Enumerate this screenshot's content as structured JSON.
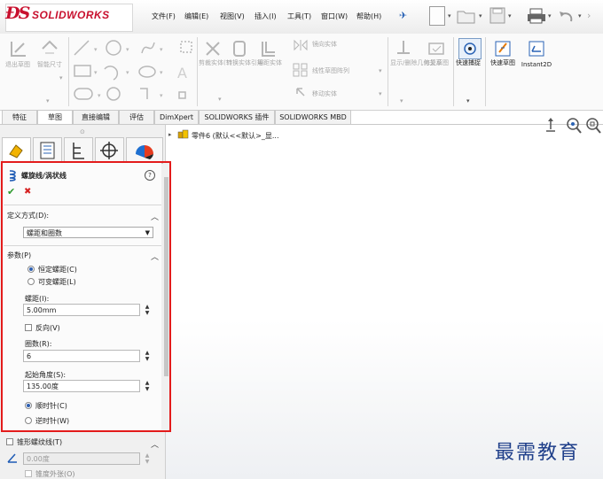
{
  "app": {
    "brand": "SOLIDWORKS",
    "brand_color": "#c8102e"
  },
  "menu": [
    "文件(F)",
    "编辑(E)",
    "视图(V)",
    "插入(I)",
    "工具(T)",
    "窗口(W)",
    "帮助(H)"
  ],
  "ribbon": {
    "groups": [
      {
        "label": "退出草图",
        "icon": "exit-sketch-icon",
        "enabled": false
      },
      {
        "label": "智能尺寸",
        "icon": "smart-dimension-icon",
        "enabled": false
      },
      {
        "label": "剪裁实体(T)",
        "icon": "trim-entities-icon",
        "enabled": false
      },
      {
        "label": "转换实体引用",
        "icon": "convert-entities-icon",
        "enabled": false
      },
      {
        "label": "等距实体",
        "icon": "offset-entities-icon",
        "enabled": false
      },
      {
        "label": "镜向实体",
        "icon": "mirror-entities-icon",
        "enabled": false
      },
      {
        "label": "线性草图阵列",
        "icon": "linear-pattern-icon",
        "enabled": false
      },
      {
        "label": "移动实体",
        "icon": "move-entities-icon",
        "enabled": false
      },
      {
        "label": "显示/删除几何关系",
        "icon": "relations-icon",
        "enabled": false
      },
      {
        "label": "修复草图",
        "icon": "repair-sketch-icon",
        "enabled": false
      },
      {
        "label": "快速捕捉",
        "icon": "quick-snap-icon",
        "enabled": true
      },
      {
        "label": "快速草图",
        "icon": "rapid-sketch-icon",
        "enabled": true
      },
      {
        "label": "Instant2D",
        "icon": "instant2d-icon",
        "enabled": true
      }
    ]
  },
  "tabs": [
    "特征",
    "草图",
    "直接编辑",
    "评估",
    "DimXpert",
    "SOLIDWORKS 插件",
    "SOLIDWORKS MBD"
  ],
  "active_tab": "草图",
  "tree": {
    "item": "零件6 (默认<<默认>_显..."
  },
  "pm": {
    "title": "螺旋线/涡状线",
    "help": "?",
    "ok": "✔",
    "cancel": "✖",
    "defined_by": {
      "label": "定义方式(D):",
      "value": "螺距和圈数"
    },
    "params": {
      "label": "参数(P)",
      "constant_pitch": "恒定螺距(C)",
      "variable_pitch": "可变螺距(L)",
      "pitch_label": "螺距(I):",
      "pitch_value": "5.00mm",
      "reverse": "反向(V)",
      "revolutions_label": "圈数(R):",
      "revolutions_value": "6",
      "start_angle_label": "起始角度(S):",
      "start_angle_value": "135.00度",
      "clockwise": "顺时针(C)",
      "counterclockwise": "逆时针(W)"
    },
    "taper": {
      "label": "锥形螺纹线(T)",
      "angle_value": "0.00度",
      "taper_outward": "锥度外张(O)"
    }
  },
  "watermark": "最需教育",
  "colors": {
    "highlight_border": "#e31b1b",
    "accent_blue": "#2a63b5"
  }
}
